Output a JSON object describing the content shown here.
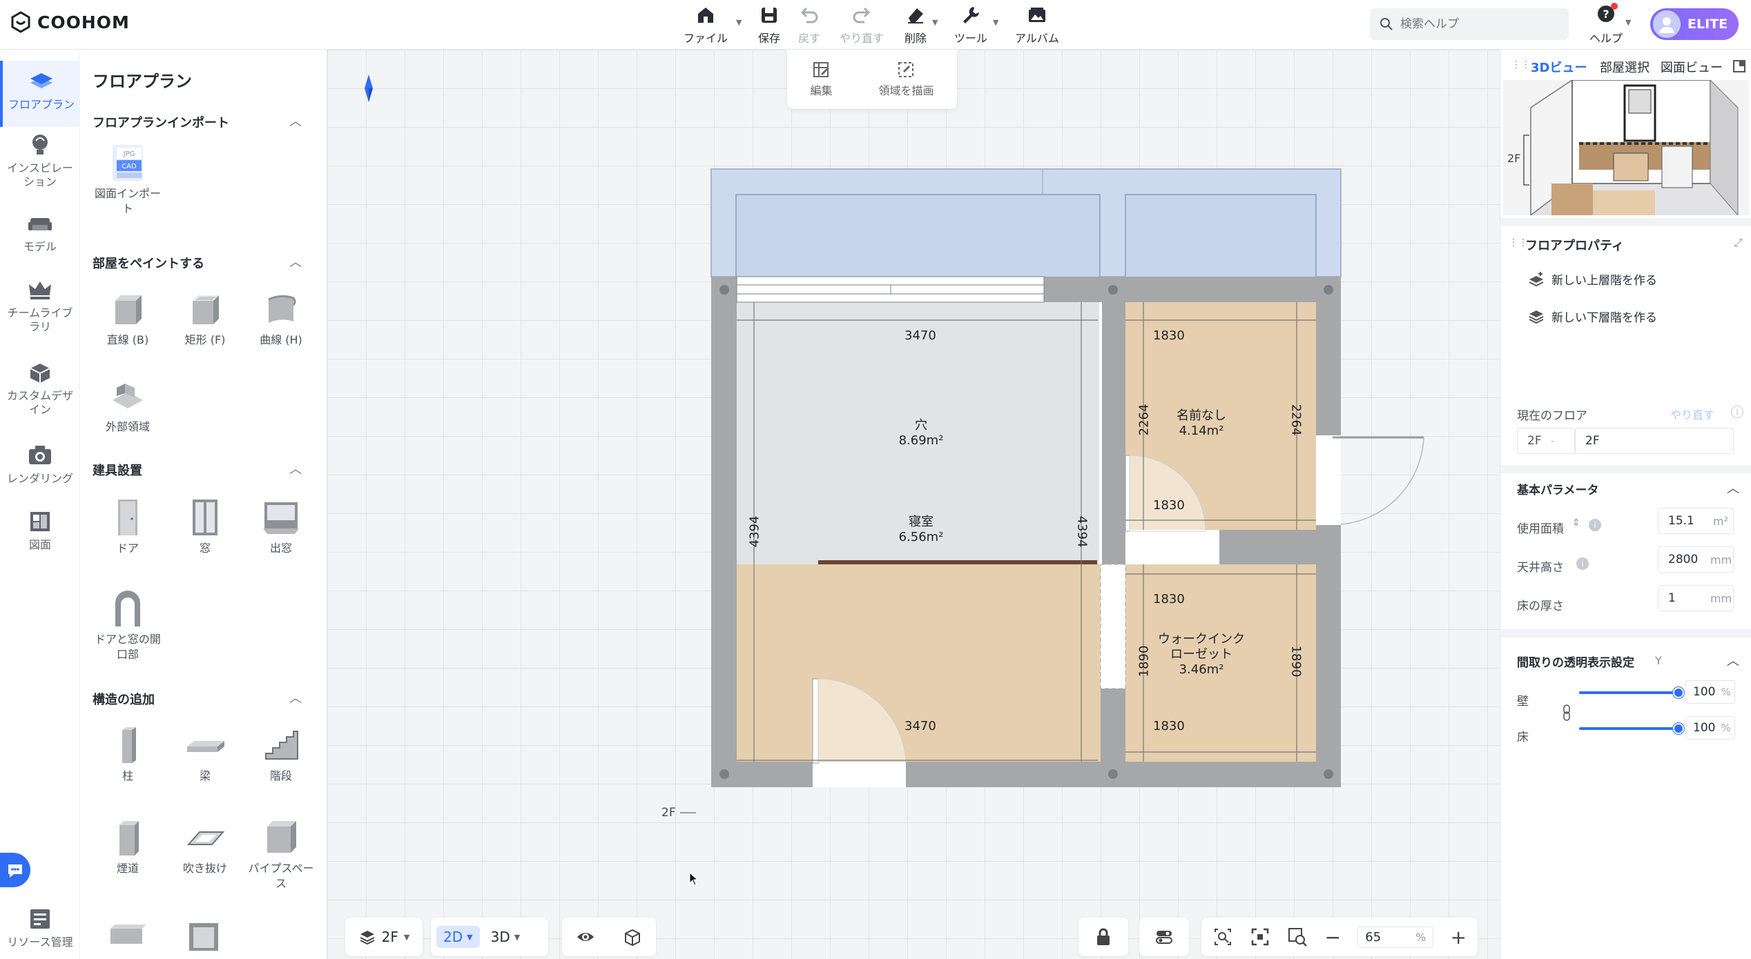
{
  "app": {
    "logo": "COOHOM"
  },
  "toolbar": {
    "file": "ファイル",
    "save": "保存",
    "undo": "戻す",
    "redo": "やり直す",
    "delete": "削除",
    "tools": "ツール",
    "album": "アルバム"
  },
  "search": {
    "placeholder": "検索ヘルプ"
  },
  "help": {
    "label": "ヘルプ"
  },
  "user": {
    "badge": "ELITE"
  },
  "leftnav": {
    "items": [
      {
        "label": "フロアプラン",
        "icon": "floorplan-icon"
      },
      {
        "label": "インスピレーション",
        "icon": "lightbulb-icon"
      },
      {
        "label": "モデル",
        "icon": "sofa-icon"
      },
      {
        "label": "チームライブラリ",
        "icon": "crown-icon"
      },
      {
        "label": "カスタムデザイン",
        "icon": "custom-design-icon"
      },
      {
        "label": "レンダリング",
        "icon": "camera-icon"
      },
      {
        "label": "図面",
        "icon": "drawing-icon"
      },
      {
        "label": "リソース管理",
        "icon": "resource-icon"
      }
    ]
  },
  "panel": {
    "title": "フロアプラン",
    "import_section": "フロアプランインポート",
    "import_tool": "図面インポート",
    "import_badges": [
      "JPG",
      "CAD"
    ],
    "paint_section": "部屋をペイントする",
    "paint_tools": [
      "直線 (B)",
      "矩形 (F)",
      "曲線 (H)",
      "外部領域"
    ],
    "fixture_section": "建具設置",
    "fixture_tools": [
      "ドア",
      "窓",
      "出窓",
      "ドアと窓の開口部"
    ],
    "structure_section": "構造の追加",
    "structure_tools": [
      "柱",
      "梁",
      "階段",
      "煙道",
      "吹き抜け",
      "パイプスペース"
    ]
  },
  "edit_toolbar": {
    "edit": "編集",
    "draw_area": "領域を描画"
  },
  "plan": {
    "floor_marker": "2F",
    "rooms": [
      {
        "name": "穴",
        "area": "8.69m²"
      },
      {
        "name": "寝室",
        "area": "6.56m²"
      },
      {
        "name": "名前なし",
        "area": "4.14m²"
      },
      {
        "name": "ウォークインクローゼット",
        "area": "3.46m²"
      }
    ],
    "dims": {
      "d3470_top": "3470",
      "d3470_bottom": "3470",
      "d4394_left": "4394",
      "d4394_right": "4394",
      "d1830_a": "1830",
      "d1830_b": "1830",
      "d1830_c": "1830",
      "d1830_d": "1830",
      "d2264_left": "2264",
      "d2264_right": "2264",
      "d1890_left": "1890",
      "d1890_right": "1890"
    }
  },
  "right_panel": {
    "tabs": [
      "3Dビュー",
      "部屋選択",
      "図面ビュー"
    ],
    "preview_floor": "2F",
    "props_title": "フロアプロパティ",
    "new_upper": "新しい上層階を作る",
    "new_lower": "新しい下層階を作る",
    "current_floor_label": "現在のフロア",
    "redo_link": "やり直す",
    "floor_code": "2F",
    "floor_name": "2F",
    "basic_params": "基本パラメータ",
    "usable_area_label": "使用面積",
    "usable_area_value": "15.1",
    "usable_area_unit": "m²",
    "ceiling_label": "天井高さ",
    "ceiling_value": "2800",
    "ceiling_unit": "mm",
    "floor_thickness_label": "床の厚さ",
    "floor_thickness_value": "1",
    "floor_thickness_unit": "mm",
    "transparency_title": "間取りの透明表示設定",
    "transparency_key": "Y",
    "wall_label": "壁",
    "wall_value": "100",
    "floor_label": "床",
    "floor_value": "100",
    "percent": "%"
  },
  "bottom": {
    "floor": "2F",
    "mode_2d": "2D",
    "mode_3d": "3D",
    "zoom": "65",
    "zoom_unit": "%"
  },
  "colors": {
    "accent": "#2f6df6",
    "wall": "#a6a7a9",
    "wood": "#e5cfae",
    "hole": "#e2e3e4",
    "balcony": "#cdd9ee"
  }
}
